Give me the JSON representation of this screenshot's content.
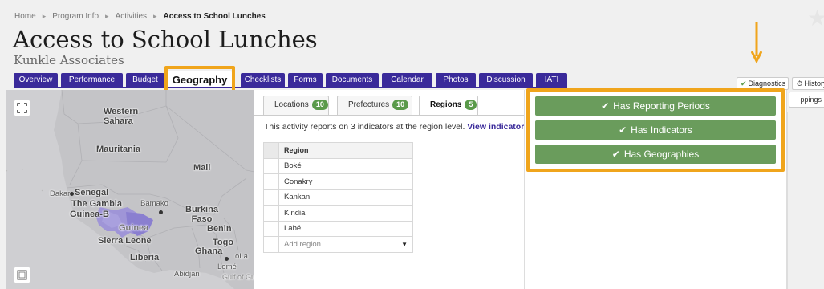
{
  "breadcrumb": [
    "Home",
    "Program Info",
    "Activities",
    "Access to School Lunches"
  ],
  "title": "Access to School Lunches",
  "subtitle": "Kunkle Associates",
  "tabs": [
    "Overview",
    "Performance",
    "Budget",
    "Geography",
    "Checklists",
    "Forms",
    "Documents",
    "Calendar",
    "Photos",
    "Discussion",
    "IATI"
  ],
  "active_tab": "Geography",
  "header_buttons": {
    "diagnostics": "Diagnostics",
    "history": "History",
    "mappings": "ppings"
  },
  "subtabs": [
    {
      "label": "Locations",
      "count": "10"
    },
    {
      "label": "Prefectures",
      "count": "10"
    },
    {
      "label": "Regions",
      "count": "5"
    }
  ],
  "report": {
    "text": "This activity reports on 3 indicators at the region level.",
    "link": "View indicators"
  },
  "region_table": {
    "header": "Region",
    "rows": [
      "Boké",
      "Conakry",
      "Kankan",
      "Kindia",
      "Labé"
    ],
    "add_placeholder": "Add region..."
  },
  "diagnostics": [
    "Has Reporting Periods",
    "Has Indicators",
    "Has Geographies"
  ],
  "map_labels": {
    "western_sahara": "Western\nSahara",
    "mauritania": "Mauritania",
    "mali": "Mali",
    "dakar": "Dakar",
    "senegal": "Senegal",
    "gambia": "The Gambia",
    "guinea_bissau": "Guinea-B",
    "bamako": "Bamako",
    "burkina": "Burkina\nFaso",
    "guinea": "Guinea",
    "benin": "Benin",
    "sierra_leone": "Sierra Leone",
    "togo": "Togo",
    "ghana": "Ghana",
    "liberia": "Liberia",
    "lome": "Lomé",
    "abidjan": "Abidjan",
    "gulf": "Gulf of Gu",
    "la": "oLa"
  },
  "colors": {
    "tab_bg": "#3a2a9a",
    "highlight": "#f0a51c",
    "success": "#6a9c5c",
    "region_fill": "#9b90d8"
  }
}
